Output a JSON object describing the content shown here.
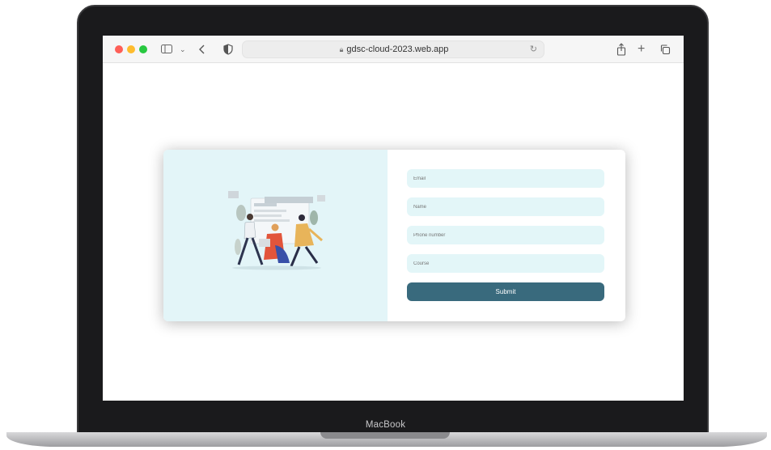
{
  "device": {
    "brand_label": "MacBook"
  },
  "browser": {
    "url": "gdsc-cloud-2023.web.app",
    "traffic_lights": {
      "close": "#fe5f57",
      "minimize": "#febc2e",
      "zoom": "#28c840"
    },
    "icons": {
      "sidebar": "sidebar-icon",
      "chevron": "chevron-down-icon",
      "back": "back-icon",
      "shield": "shield-icon",
      "lock": "lock-icon",
      "reload": "reload-icon",
      "share": "share-icon",
      "new_tab": "plus-icon",
      "tabs": "tabs-overview-icon"
    }
  },
  "form": {
    "email_placeholder": "Email",
    "name_placeholder": "Name",
    "phone_placeholder": "Phone number",
    "course_placeholder": "Course",
    "submit_label": "Submit"
  },
  "colors": {
    "accent": "#396a7d",
    "panel": "#e3f5f8",
    "field": "#e3f6f8"
  }
}
